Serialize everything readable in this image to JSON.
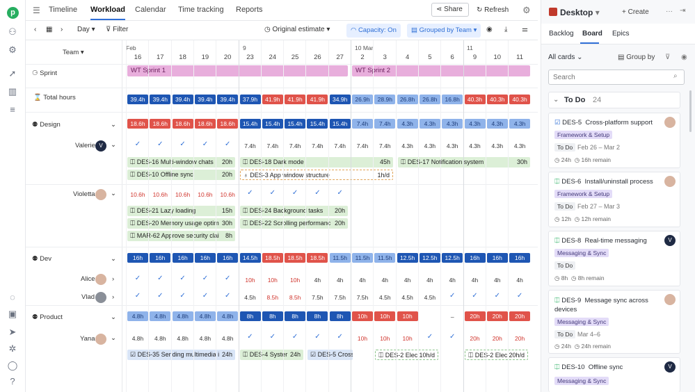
{
  "topnav": {
    "tabs": [
      "Timeline",
      "Workload",
      "Calendar",
      "Time tracking",
      "Reports"
    ],
    "active": "Workload",
    "share": "Share",
    "refresh": "Refresh"
  },
  "toolbar": {
    "range": "Day",
    "filter": "Filter",
    "estimate": "Original estimate",
    "capacity": "Capacity: On",
    "grouped": "Grouped by Team"
  },
  "left": {
    "team": "Team",
    "sprint": "Sprint",
    "total": "Total hours",
    "design": "Design",
    "valerie": "Valerie",
    "violetta": "Violetta",
    "dev": "Dev",
    "alice": "Alice",
    "vlad": "Vlad",
    "product": "Product",
    "yana": "Yana",
    "valerie_initial": "V"
  },
  "months": {
    "feb": "Feb",
    "m9": "9",
    "mar": "10 Mar",
    "m11": "11"
  },
  "days": [
    "16",
    "17",
    "18",
    "19",
    "20",
    "23",
    "24",
    "25",
    "26",
    "27",
    "2",
    "3",
    "4",
    "5",
    "6",
    "9",
    "10",
    "11"
  ],
  "sprints": {
    "s1": "WT Sprint 1",
    "s2": "WT Sprint 2"
  },
  "total_hours": [
    "39.4h",
    "39.4h",
    "39.4h",
    "39.4h",
    "39.4h",
    "37.9h",
    "41.9h",
    "41.9h",
    "41.9h",
    "34.9h",
    "26.9h",
    "28.9h",
    "26.8h",
    "26.8h",
    "16.8h",
    "40.3h",
    "40.3h",
    "40.3h"
  ],
  "design_hours": [
    "18.6h",
    "18.6h",
    "18.6h",
    "18.6h",
    "18.6h",
    "15.4h",
    "15.4h",
    "15.4h",
    "15.4h",
    "15.4h",
    "7.4h",
    "7.4h",
    "4.3h",
    "4.3h",
    "4.3h",
    "4.3h",
    "4.3h",
    "4.3h"
  ],
  "valerie_hours": [
    "7.4h",
    "7.4h",
    "7.4h",
    "7.4h",
    "7.4h",
    "7.4h",
    "7.4h",
    "4.3h",
    "4.3h",
    "4.3h",
    "4.3h",
    "4.3h",
    "4.3h"
  ],
  "violetta_hours": [
    "10.6h",
    "10.6h",
    "10.6h",
    "10.6h",
    "10.6h"
  ],
  "dev_hours": [
    "16h",
    "16h",
    "16h",
    "16h",
    "16h",
    "14.5h",
    "18.5h",
    "18.5h",
    "18.5h",
    "11.5h",
    "11.5h",
    "11.5h",
    "12.5h",
    "12.5h",
    "12.5h",
    "16h",
    "16h",
    "16h"
  ],
  "alice_hours": [
    "10h",
    "10h",
    "10h",
    "4h",
    "4h",
    "4h",
    "4h",
    "4h",
    "4h",
    "4h",
    "4h",
    "4h",
    "4h"
  ],
  "vlad_hours": [
    "4.5h",
    "8.5h",
    "8.5h",
    "7.5h",
    "7.5h",
    "7.5h",
    "4.5h",
    "4.5h",
    "4.5h"
  ],
  "product_hours": [
    "4.8h",
    "4.8h",
    "4.8h",
    "4.8h",
    "4.8h",
    "8h",
    "8h",
    "8h",
    "8h",
    "8h",
    "10h",
    "10h",
    "10h",
    "–",
    "20h",
    "20h",
    "20h"
  ],
  "yana_hours": [
    "4.8h",
    "4.8h",
    "4.8h",
    "4.8h",
    "4.8h",
    "10h",
    "10h",
    "10h",
    "20h",
    "20h",
    "20h"
  ],
  "tasks": {
    "t1": {
      "name": "DES-16 Multi-window chats",
      "h": "20h"
    },
    "t2": {
      "name": "DES-10 Offline sync",
      "h": "20h"
    },
    "t3": {
      "name": "DES-18 Dark mode",
      "h": "45h"
    },
    "t4": {
      "name": "DES-3 App window structure",
      "h": "1h/d"
    },
    "t5": {
      "name": "DES-17 Notification system",
      "h": "30h"
    },
    "t6": {
      "name": "DES-21 Lazy loading",
      "h": "15h"
    },
    "t7": {
      "name": "DES-20 Memory usage optim",
      "h": "30h"
    },
    "t8": {
      "name": "MAR-62 Approve security clai",
      "h": "8h"
    },
    "t9": {
      "name": "DES-24 Background tasks",
      "h": "20h"
    },
    "t10": {
      "name": "DES-22 Scrolling performanc",
      "h": "20h"
    },
    "t11": {
      "name": "DES-35 Sending multimedia i",
      "h": "24h"
    },
    "t12": {
      "name": "DES-4 Syster",
      "h": "24h"
    },
    "t13": {
      "name": "DES-5 Cross-",
      "h": ""
    },
    "t14": {
      "name": "DES-2 Elec",
      "h": "10h/d"
    },
    "t15": {
      "name": "DES-2 Elec",
      "h": "20h/d"
    }
  },
  "panel": {
    "title": "Desktop",
    "create": "Create",
    "tabs": [
      "Backlog",
      "Board",
      "Epics"
    ],
    "active": "Board",
    "allcards": "All cards",
    "groupby": "Group by",
    "search_placeholder": "Search",
    "todo": "To Do",
    "todo_count": "24",
    "cards": [
      {
        "id": "DES-5",
        "title": "Cross-platform support",
        "tag": "Framework & Setup",
        "status": "To Do",
        "dates": "Feb 26 – Mar 2",
        "est": "24h",
        "remain": "16h remain",
        "avatar": ""
      },
      {
        "id": "DES-6",
        "title": "Install/uninstall process",
        "tag": "Framework & Setup",
        "status": "To Do",
        "dates": "Feb 27 – Mar 3",
        "est": "12h",
        "remain": "12h remain",
        "avatar": ""
      },
      {
        "id": "DES-8",
        "title": "Real-time messaging",
        "tag": "Messaging & Sync",
        "status": "To Do",
        "dates": "",
        "est": "8h",
        "remain": "8h remain",
        "avatar": "V"
      },
      {
        "id": "DES-9",
        "title": "Message sync across",
        "title2": "devices",
        "tag": "Messaging & Sync",
        "status": "To Do",
        "dates": "Mar 4–6",
        "est": "24h",
        "remain": "24h remain",
        "avatar": ""
      },
      {
        "id": "DES-10",
        "title": "Offline sync",
        "tag": "Messaging & Sync",
        "status": "",
        "dates": "",
        "est": "",
        "remain": "",
        "avatar": "V"
      }
    ]
  }
}
